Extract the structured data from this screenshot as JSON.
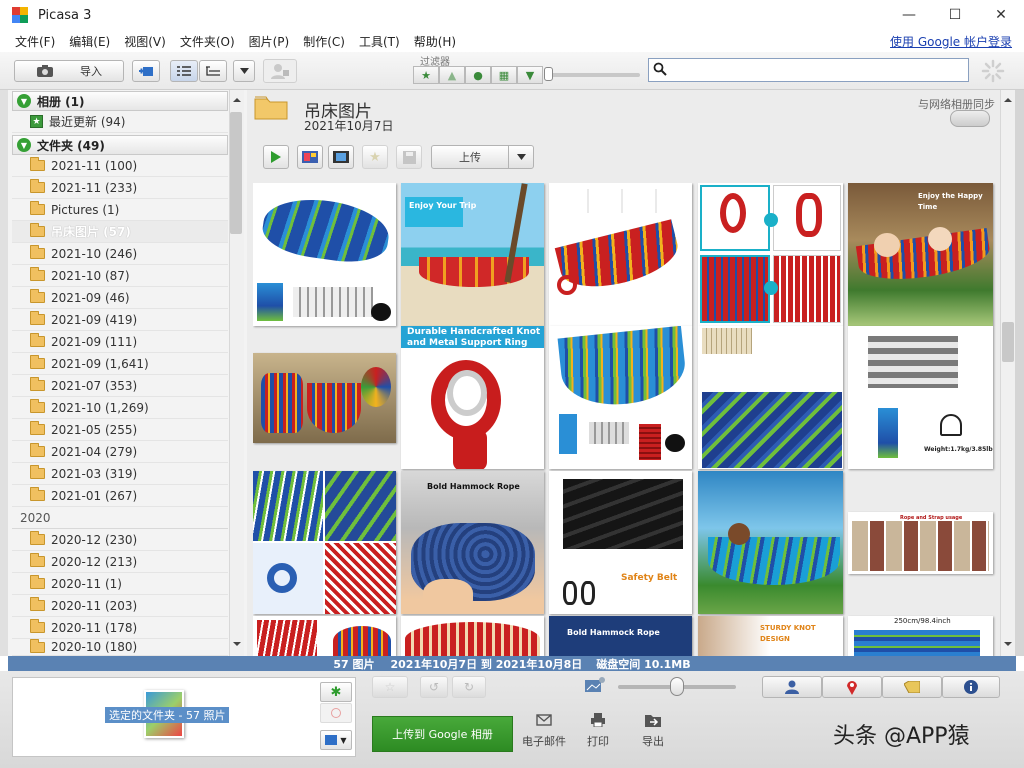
{
  "app": {
    "title": "Picasa 3"
  },
  "menu": {
    "items": [
      "文件(F)",
      "编辑(E)",
      "视图(V)",
      "文件夹(O)",
      "图片(P)",
      "制作(C)",
      "工具(T)",
      "帮助(H)"
    ],
    "login_link": "使用 Google 帐户登录"
  },
  "toolbar": {
    "import_label": "导入",
    "filter_label": "过滤器",
    "search_placeholder": ""
  },
  "sidebar": {
    "albums_group": "相册 (1)",
    "recent": "最近更新 (94)",
    "folders_group": "文件夹 (49)",
    "folders": [
      "2021-11 (100)",
      "2021-11 (233)",
      "Pictures (1)",
      "吊床图片 (57)",
      "2021-10 (246)",
      "2021-10 (87)",
      "2021-09 (46)",
      "2021-09 (419)",
      "2021-09 (111)",
      "2021-09 (1,641)",
      "2021-07 (353)",
      "2021-10 (1,269)",
      "2021-05 (255)",
      "2021-04 (279)",
      "2021-03 (319)",
      "2021-01 (267)"
    ],
    "year": "2020",
    "folders_2020": [
      "2020-12 (230)",
      "2020-12 (213)",
      "2020-11 (1)",
      "2020-11 (203)",
      "2020-11 (178)",
      "2020-10 (180)"
    ]
  },
  "album": {
    "title": "吊床图片",
    "date": "2021年10月7日",
    "sync_label": "与网络相册同步",
    "upload_label": "上传"
  },
  "photos": {
    "texts": {
      "enjoy_trip": "Enjoy Your Trip",
      "durable": "Durable Handcrafted Knot and Metal Support Ring",
      "enjoy_happy": "Enjoy the Happy Time",
      "bold_rope": "Bold Hammock Rope",
      "bold_rope2": "Bold Hammock Rope",
      "safety_belt": "Safety Belt",
      "sturdy_knot": "STURDY KNOT DESIGN",
      "size": "250cm/98.4inch",
      "rope_strap": "Rope and Strap usage",
      "weight": "Weight:1.7kg/3.85lb"
    }
  },
  "status": {
    "count": "57 图片",
    "range": "2021年10月7日 到 2021年10月8日",
    "disk": "磁盘空间 10.1MB"
  },
  "tray": {
    "caption": "选定的文件夹 - 57 照片"
  },
  "actions": {
    "upload_google": "上传到 Google 相册",
    "email": "电子邮件",
    "print": "打印",
    "export": "导出"
  },
  "watermark": "头条 @APP猿",
  "colors": {
    "status_bar": "#5a82b3",
    "upload_green": "#3a9a2e",
    "link_blue": "#1a3fb0"
  }
}
